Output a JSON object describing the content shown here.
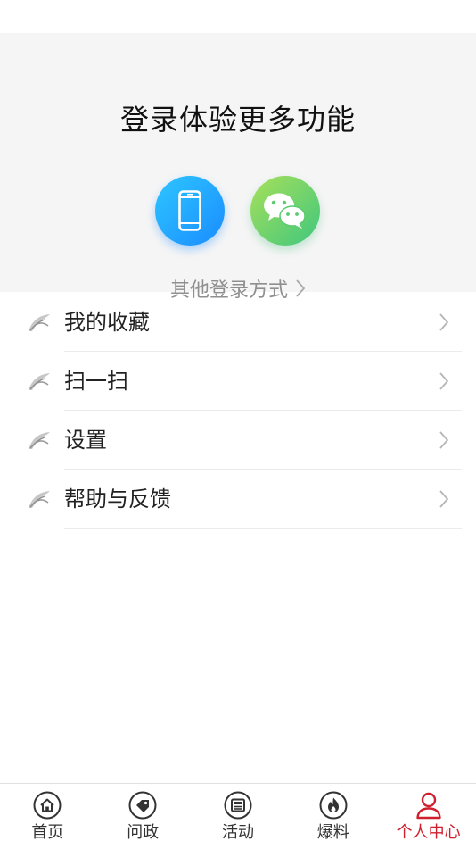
{
  "login": {
    "title": "登录体验更多功能",
    "phone_icon": "phone-icon",
    "wechat_icon": "wechat-icon",
    "other_login_label": "其他登录方式",
    "phone_color": "#1a8cff",
    "wechat_color": "#3fc77e"
  },
  "menu": {
    "items": [
      {
        "label": "我的收藏",
        "icon": "leaf-icon"
      },
      {
        "label": "扫一扫",
        "icon": "leaf-icon"
      },
      {
        "label": "设置",
        "icon": "leaf-icon"
      },
      {
        "label": "帮助与反馈",
        "icon": "leaf-icon"
      }
    ]
  },
  "tabbar": {
    "active_color": "#d0202e",
    "tabs": [
      {
        "label": "首页",
        "icon": "home-icon",
        "active": false
      },
      {
        "label": "问政",
        "icon": "tag-icon",
        "active": false
      },
      {
        "label": "活动",
        "icon": "newspaper-icon",
        "active": false
      },
      {
        "label": "爆料",
        "icon": "flame-icon",
        "active": false
      },
      {
        "label": "个人中心",
        "icon": "user-icon",
        "active": true
      }
    ]
  }
}
